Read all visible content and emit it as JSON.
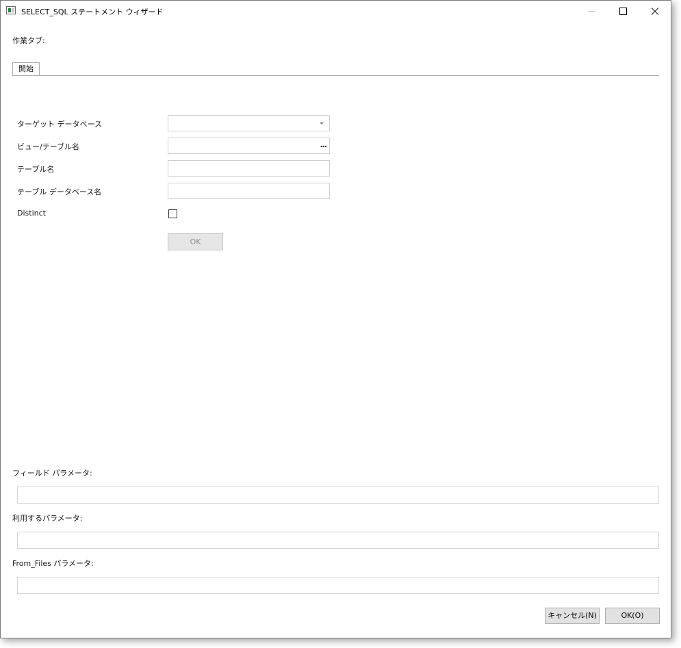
{
  "window": {
    "title": "SELECT_SQL ステートメント ウィザード"
  },
  "work_tab_label": "作業タブ:",
  "tabs": [
    {
      "label": "開始"
    }
  ],
  "form": {
    "target_db_label": "ターゲット データベース",
    "target_db_value": "",
    "view_table_label": "ビュー/テーブル名",
    "view_table_value": "",
    "browse_icon_glyph": "...",
    "table_name_label": "テーブル名",
    "table_name_value": "",
    "table_db_label": "テーブル データベース名",
    "table_db_value": "",
    "distinct_label": "Distinct",
    "distinct_checked": false,
    "ok_label": "OK"
  },
  "params": {
    "field_label": "フィールド パラメータ:",
    "field_value": "",
    "used_label": "利用するパラメータ:",
    "used_value": "",
    "from_files_label": "From_Files パラメータ:",
    "from_files_value": ""
  },
  "footer": {
    "cancel_label": "キャンセル(N)",
    "ok_label": "OK(O)"
  }
}
